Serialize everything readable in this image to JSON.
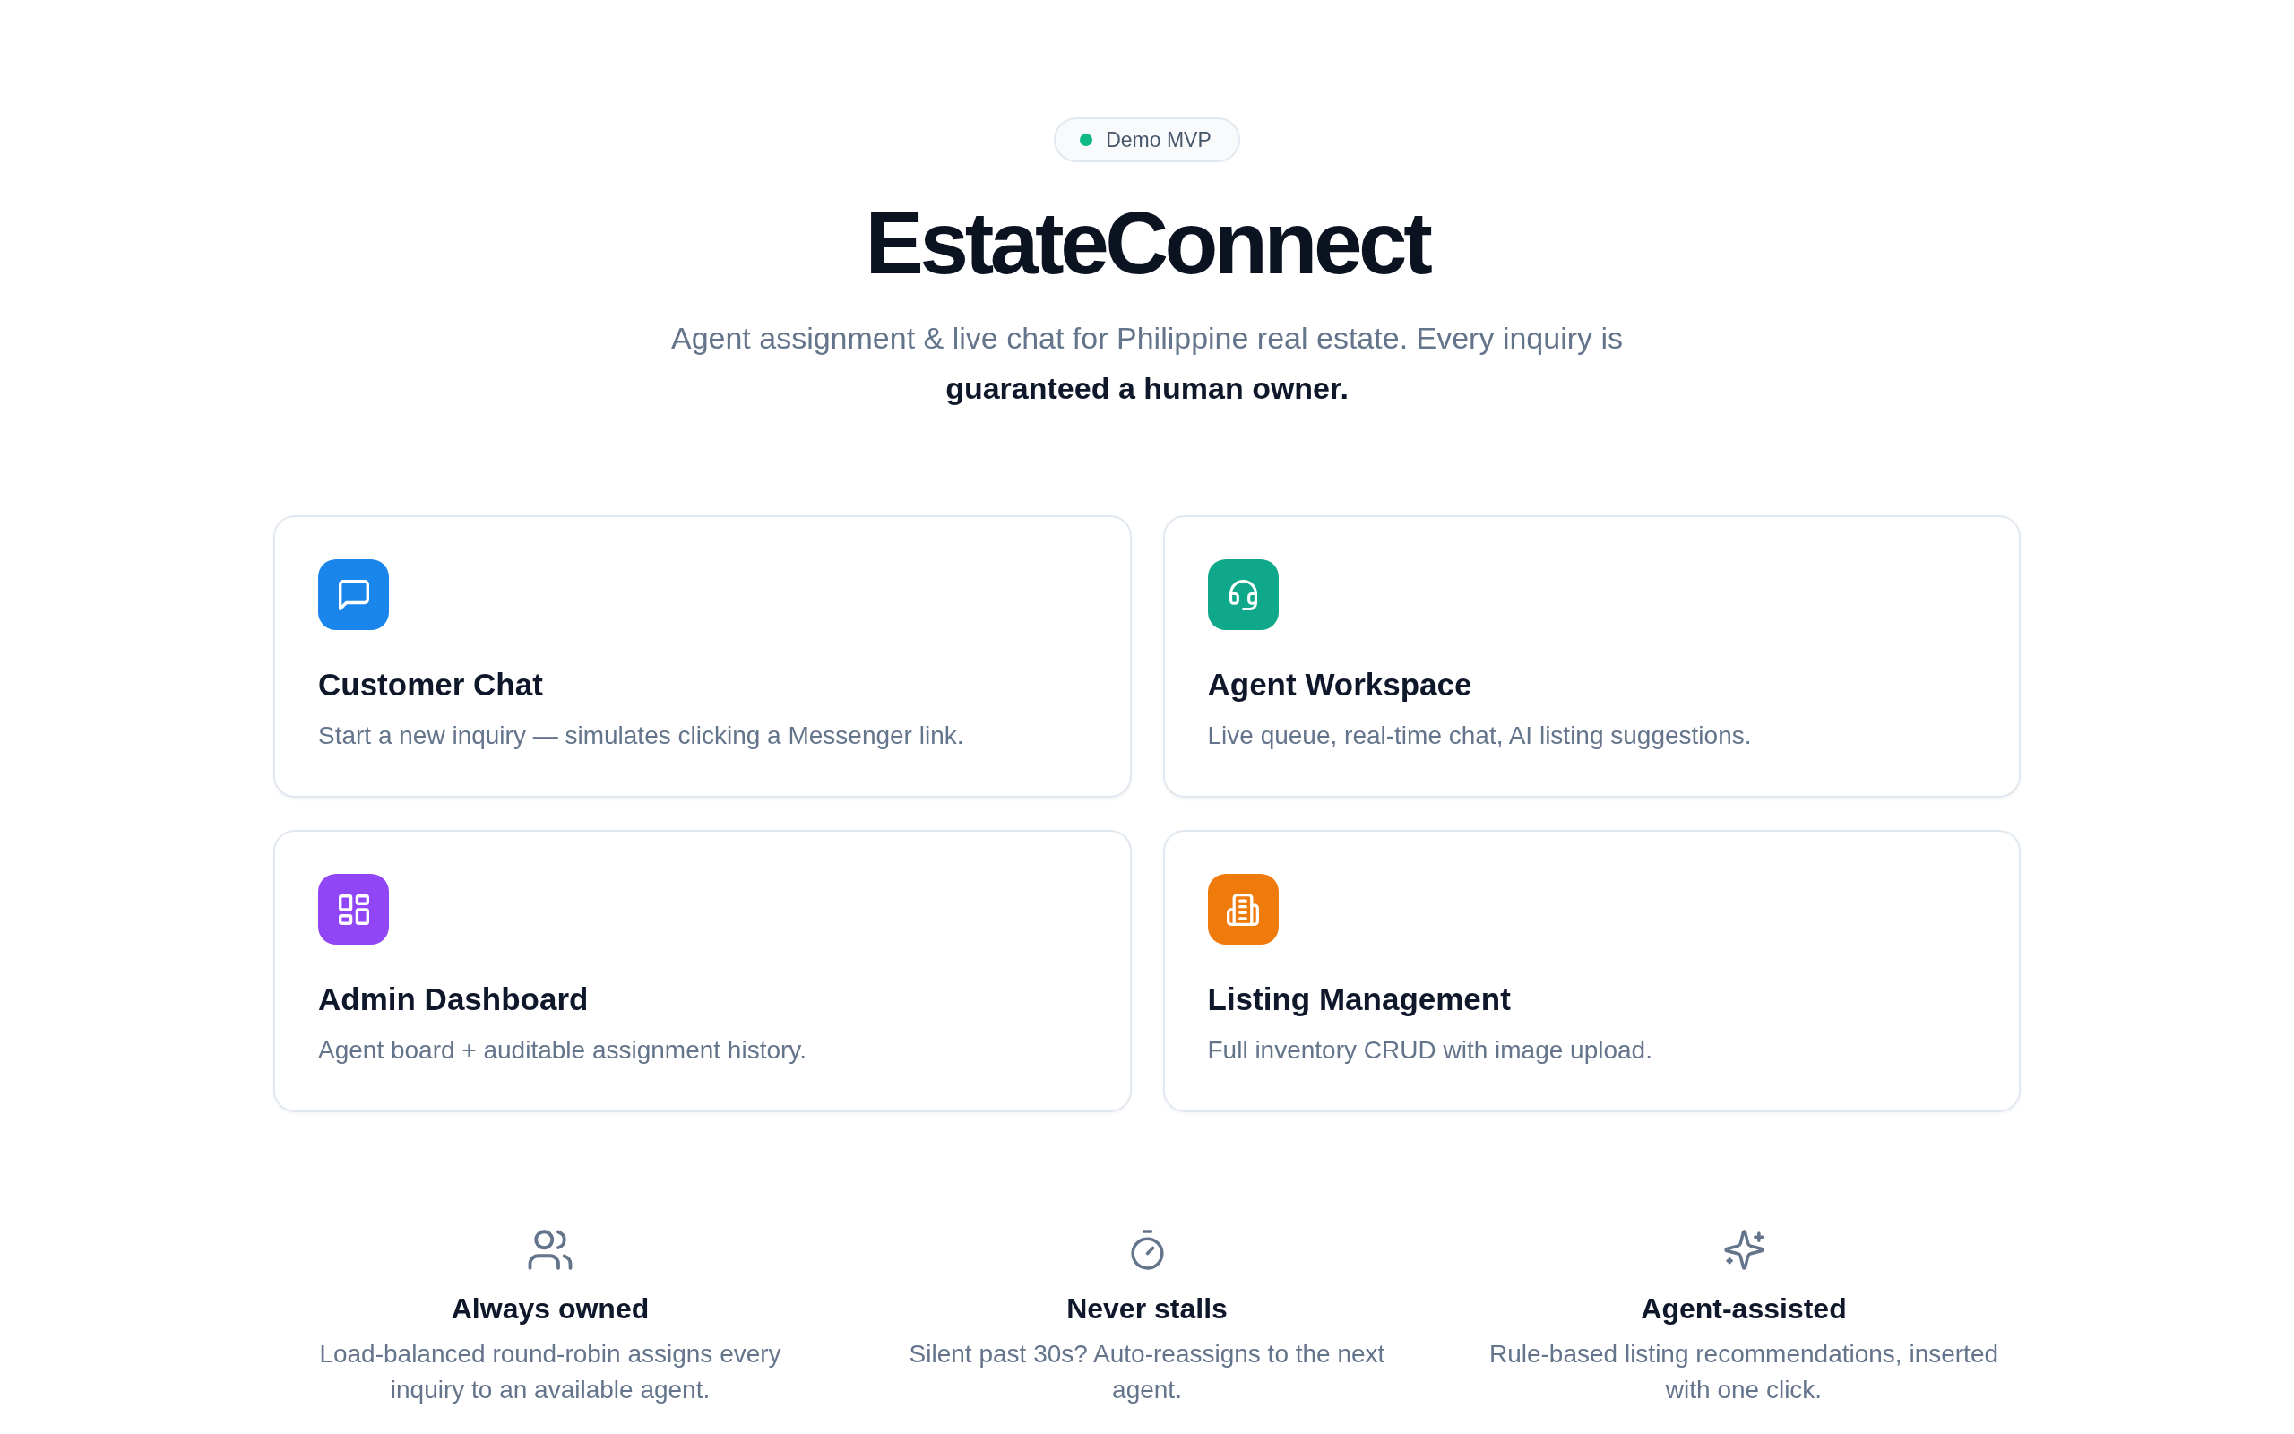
{
  "badge": {
    "label": "Demo MVP"
  },
  "title": "EstateConnect",
  "subtitle": "Agent assignment & live chat for Philippine real estate. Every inquiry is **guaranteed a human owner.**",
  "cards": [
    {
      "title": "Customer Chat",
      "description": "Start a new inquiry — simulates clicking a Messenger link.",
      "color": "#1a86ec"
    },
    {
      "title": "Agent Workspace",
      "description": "Live queue, real-time chat, AI listing suggestions.",
      "color": "#10a88a"
    },
    {
      "title": "Admin Dashboard",
      "description": "Agent board + auditable assignment history.",
      "color": "#9046f4"
    },
    {
      "title": "Listing Management",
      "description": "Full inventory CRUD with image upload.",
      "color": "#f07b0d"
    }
  ],
  "features": [
    {
      "title": "Always owned",
      "description": "Load-balanced round-robin assigns every inquiry to an available agent."
    },
    {
      "title": "Never stalls",
      "description": "Silent past 30s? Auto-reassigns to the next agent."
    },
    {
      "title": "Agent-assisted",
      "description": "Rule-based listing recommendations, inserted with one click."
    }
  ]
}
